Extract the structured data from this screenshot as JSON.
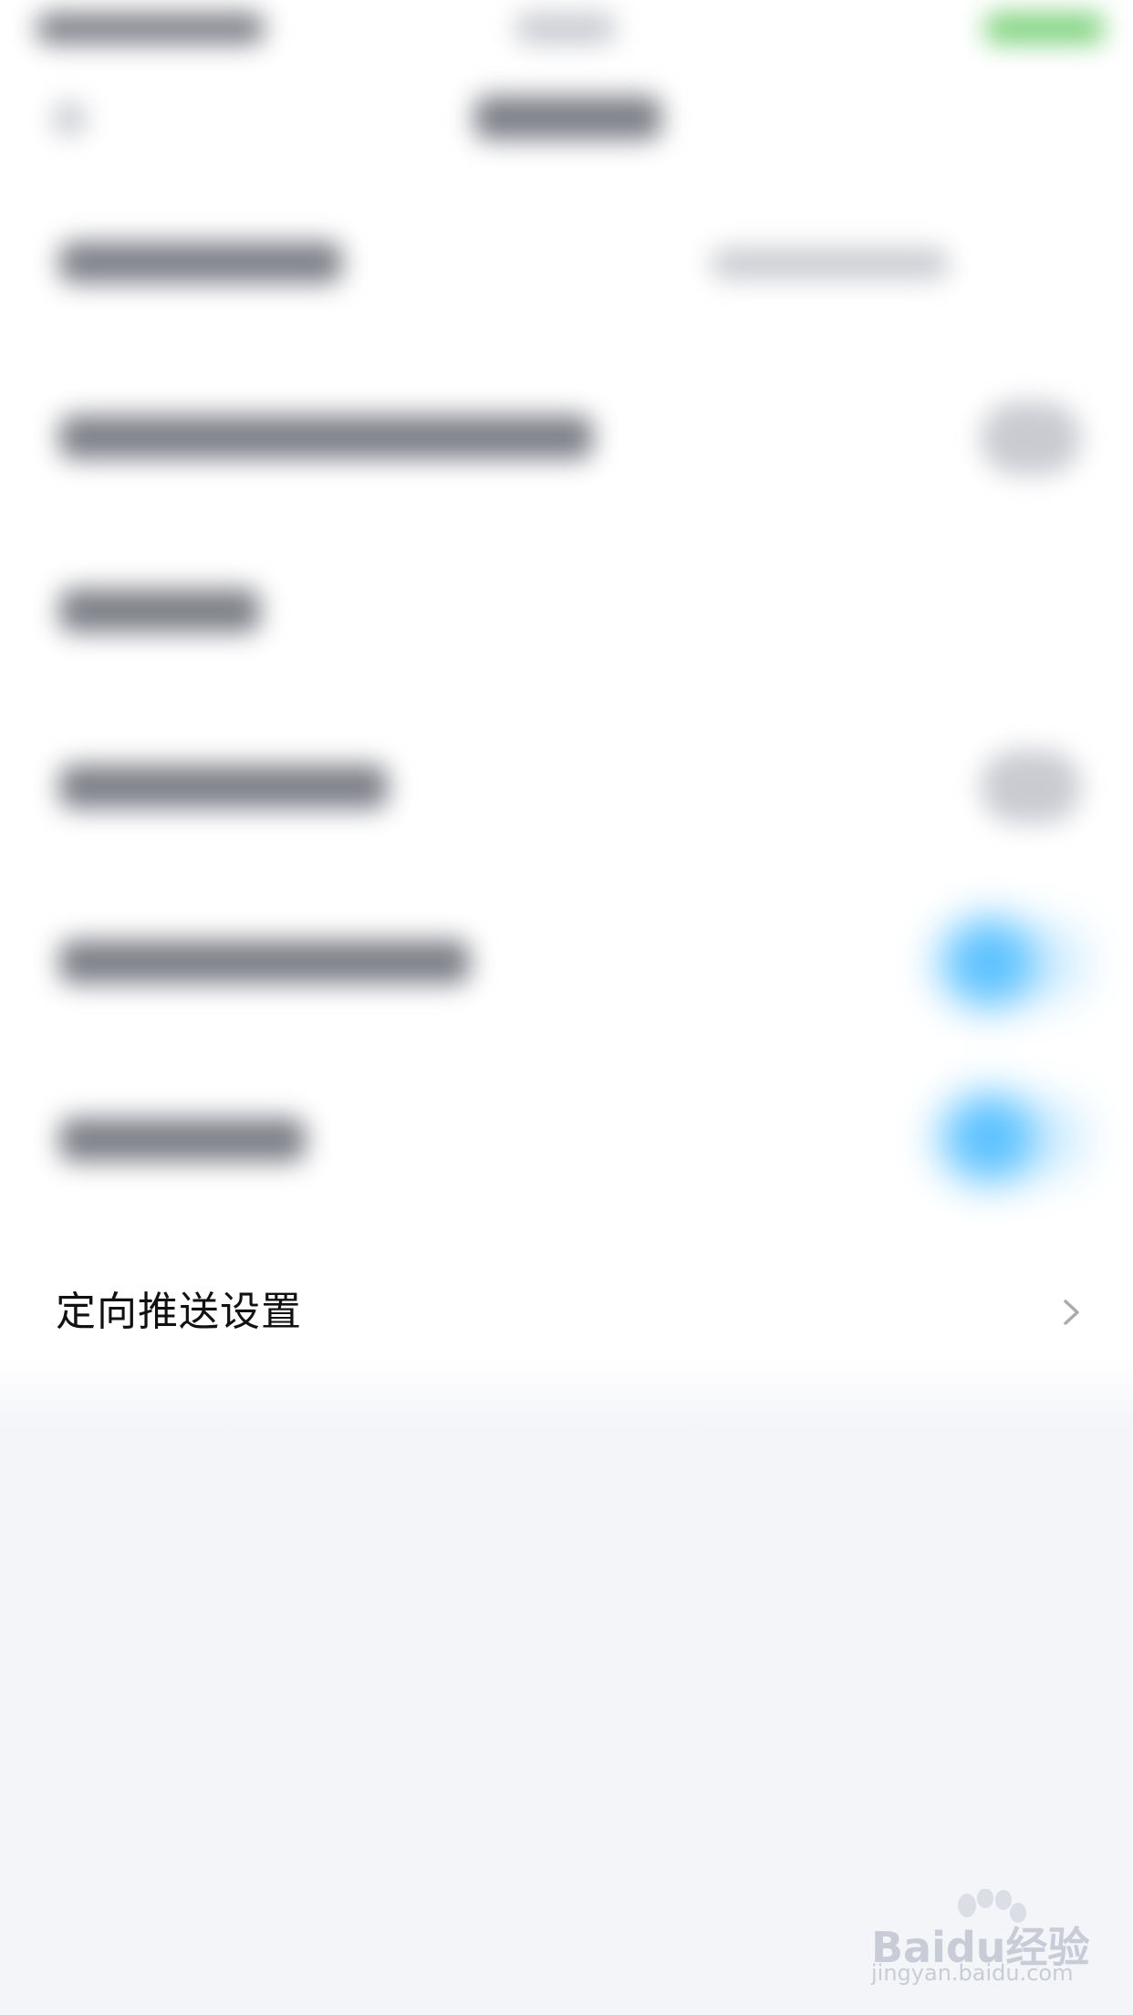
{
  "settings": {
    "items": [
      {
        "label": "定向推送设置",
        "type": "link",
        "chevron": "chevron-right-icon"
      }
    ]
  },
  "watermark": {
    "brand": "Baidu经验",
    "url": "jingyan.baidu.com"
  },
  "colors": {
    "toggle_on": "#5cc2ff",
    "background": "#f4f5f9",
    "panel": "#ffffff"
  }
}
